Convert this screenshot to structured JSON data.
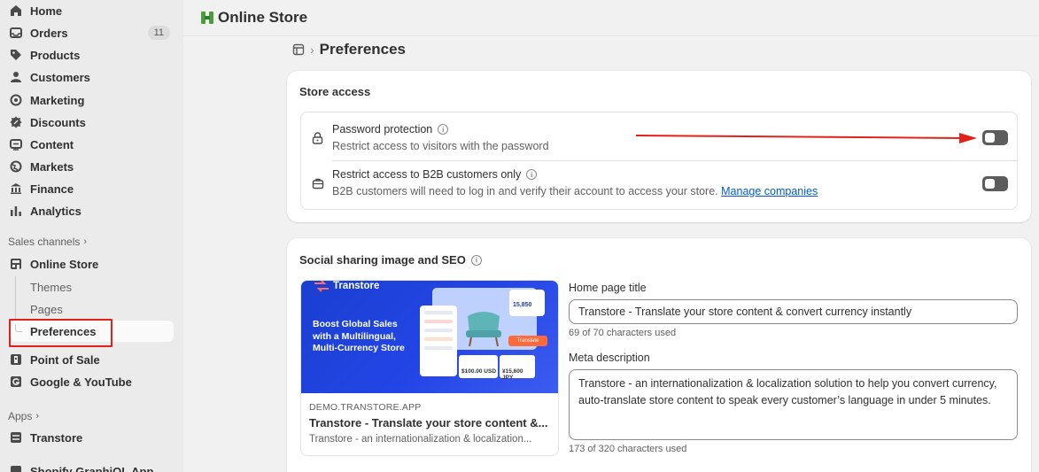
{
  "sidebar": {
    "items": [
      {
        "label": "Home",
        "icon": "home-icon"
      },
      {
        "label": "Orders",
        "icon": "inbox-icon",
        "count": "11"
      },
      {
        "label": "Products",
        "icon": "tag-icon"
      },
      {
        "label": "Customers",
        "icon": "person-icon"
      },
      {
        "label": "Marketing",
        "icon": "target-icon"
      },
      {
        "label": "Discounts",
        "icon": "discount-icon"
      },
      {
        "label": "Content",
        "icon": "content-icon"
      },
      {
        "label": "Markets",
        "icon": "globe-icon"
      },
      {
        "label": "Finance",
        "icon": "bank-icon"
      },
      {
        "label": "Analytics",
        "icon": "bar-chart-icon"
      }
    ],
    "sales_channels_label": "Sales channels",
    "online_store_label": "Online Store",
    "online_store_sub": [
      "Themes",
      "Pages",
      "Preferences"
    ],
    "point_of_sale_label": "Point of Sale",
    "google_label": "Google & YouTube",
    "apps_label": "Apps",
    "transtore_label": "Transtore",
    "cut_off_label": "Shopify GraphiQL App"
  },
  "topbar": {
    "app_title": "Online Store"
  },
  "breadcrumb": {
    "title": "Preferences"
  },
  "store_access": {
    "title": "Store access",
    "password": {
      "title": "Password protection",
      "desc": "Restrict access to visitors with the password",
      "enabled": false
    },
    "b2b": {
      "title": "Restrict access to B2B customers only",
      "desc": "B2B customers will need to log in and verify their account to access your store.",
      "link": "Manage companies",
      "enabled": false
    }
  },
  "seo": {
    "title": "Social sharing image and SEO",
    "preview": {
      "domain": "DEMO.TRANSTORE.APP",
      "title": "Transtore - Translate your store content &...",
      "desc": "Transtore - an internationalization & localization...",
      "brand": "Transtore",
      "headline": [
        "Boost Global Sales",
        "with a Multilingual,",
        "Multi-Currency Store"
      ],
      "price1": "$100.00 USD",
      "price2": "¥15,600 JPY",
      "stat": "15,850",
      "button": "Translate"
    },
    "home_title_label": "Home page title",
    "home_title_value": "Transtore - Translate your store content & convert currency instantly",
    "home_title_hint": "69 of 70 characters used",
    "meta_label": "Meta description",
    "meta_value": "Transtore - an internationalization & localization solution to help you convert currency, auto-translate store content to speak every customer’s language in under 5 minutes.",
    "meta_hint": "173 of 320 characters used"
  },
  "colors": {
    "accent_red": "#e0231a",
    "link": "#005bd3",
    "brand_green": "#4b9f3a"
  }
}
